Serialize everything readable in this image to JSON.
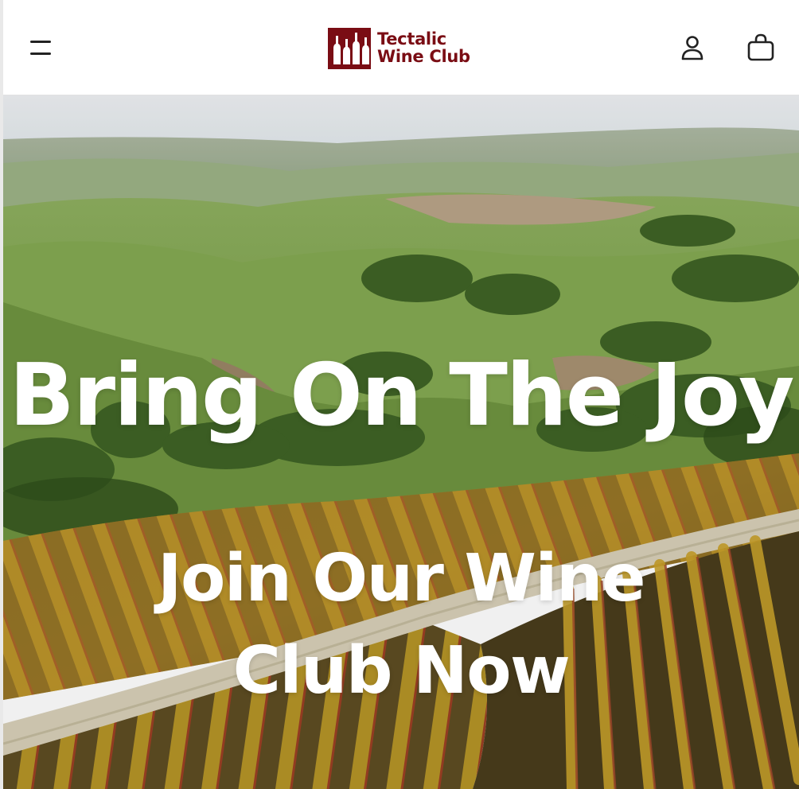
{
  "header": {
    "menu_icon": "hamburger-menu-icon",
    "logo": {
      "line1": "Tectalic",
      "line2": "Wine Club",
      "color": "#7a0d14"
    },
    "account_icon": "user-icon",
    "cart_icon": "shopping-bag-icon"
  },
  "hero": {
    "title": "Bring On The Joy",
    "subtitle": "Join Our Wine Club Now",
    "background": "vineyard-hills-photo",
    "text_color": "#ffffff"
  }
}
